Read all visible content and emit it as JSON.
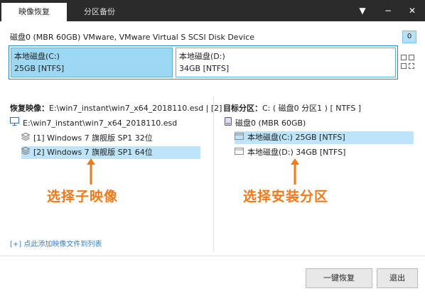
{
  "tabs": [
    {
      "label": "映像恢复"
    },
    {
      "label": "分区备份"
    }
  ],
  "window_controls": {
    "menu": "▼",
    "minimize": "−",
    "close": "✕"
  },
  "disk": {
    "header": "磁盘0 (MBR 60GB) VMware, VMware Virtual S SCSI Disk Device",
    "badge": "0",
    "partitions": [
      {
        "name": "本地磁盘(C:)",
        "detail": "25GB [NTFS]"
      },
      {
        "name": "本地磁盘(D:)",
        "detail": "34GB [NTFS]"
      }
    ]
  },
  "restore_panel": {
    "title_label": "恢复映像：",
    "title_path": "E:\\win7_instant\\win7_x64_2018110.esd | [2]",
    "root": "E:\\win7_instant\\win7_x64_2018110.esd",
    "items": [
      {
        "label": "[1] Windows 7 旗舰版 SP1 32位"
      },
      {
        "label": "[2] Windows 7 旗舰版 SP1 64位"
      }
    ],
    "add_link": "[+] 点此添加映像文件到列表"
  },
  "target_panel": {
    "title_label": "目标分区：",
    "title_value": "C: ( 磁盘0 分区1 ) [ NTFS ]",
    "disk_label": "磁盘0 (MBR 60GB)",
    "items": [
      {
        "label": "本地磁盘(C:) 25GB [NTFS]"
      },
      {
        "label": "本地磁盘(D:) 34GB [NTFS]"
      }
    ]
  },
  "callouts": {
    "left": "选择子映像",
    "right": "选择安装分区"
  },
  "buttons": {
    "primary": "一键恢复",
    "exit": "退出"
  },
  "colors": {
    "accent_blue": "#1d8ad8",
    "selection": "#bde4f8",
    "callout_orange": "#f07a1a",
    "titlebar": "#2b2b2b"
  }
}
